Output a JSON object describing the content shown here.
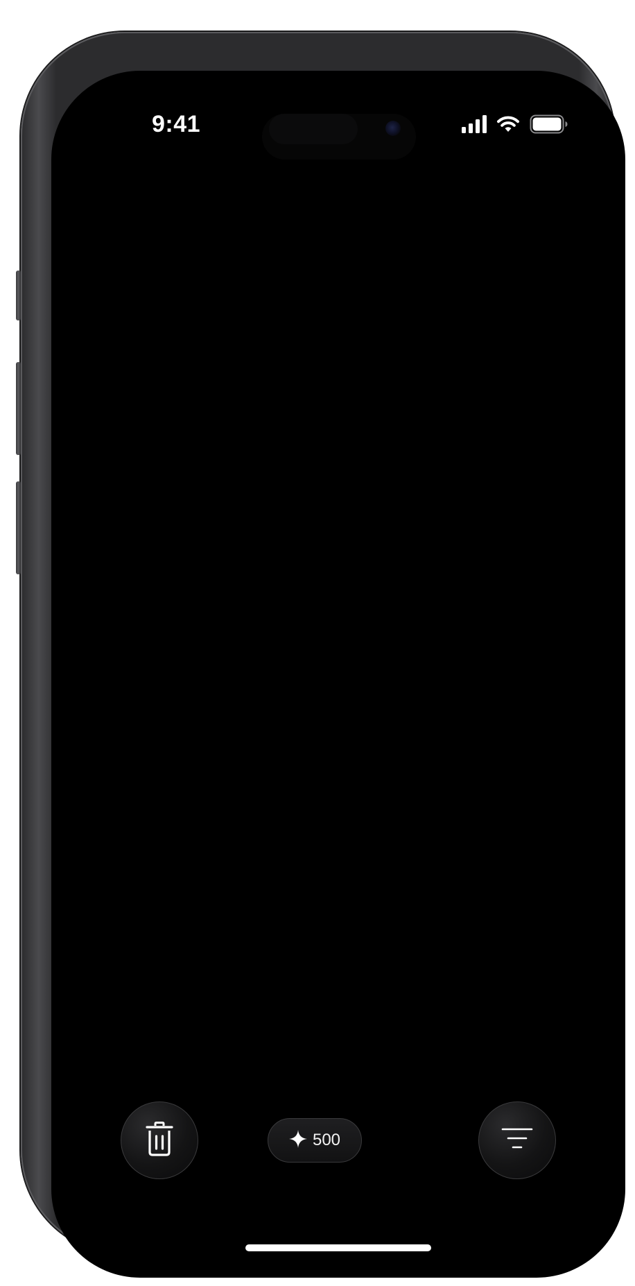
{
  "status_bar": {
    "time": "9:41",
    "icons": [
      "cellular-signal-icon",
      "wifi-icon",
      "battery-icon"
    ]
  },
  "toolbar": {
    "delete_icon": "trash-icon",
    "credits": {
      "icon": "sparkle-icon",
      "value": "500"
    },
    "filter_icon": "filter-icon"
  },
  "colors": {
    "screen_background": "#000000",
    "button_border": "#3a3a3c",
    "foreground": "#ffffff"
  }
}
